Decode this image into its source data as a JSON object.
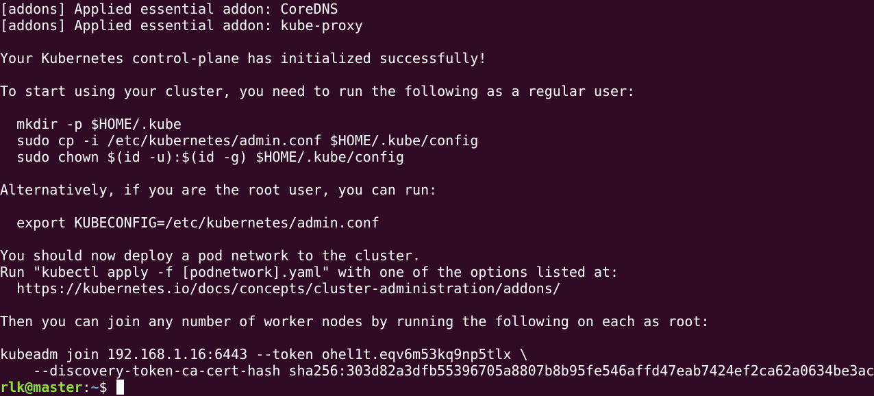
{
  "terminal": {
    "lines": [
      "[addons] Applied essential addon: CoreDNS",
      "[addons] Applied essential addon: kube-proxy",
      "",
      "Your Kubernetes control-plane has initialized successfully!",
      "",
      "To start using your cluster, you need to run the following as a regular user:",
      "",
      "  mkdir -p $HOME/.kube",
      "  sudo cp -i /etc/kubernetes/admin.conf $HOME/.kube/config",
      "  sudo chown $(id -u):$(id -g) $HOME/.kube/config",
      "",
      "Alternatively, if you are the root user, you can run:",
      "",
      "  export KUBECONFIG=/etc/kubernetes/admin.conf",
      "",
      "You should now deploy a pod network to the cluster.",
      "Run \"kubectl apply -f [podnetwork].yaml\" with one of the options listed at:",
      "  https://kubernetes.io/docs/concepts/cluster-administration/addons/",
      "",
      "Then you can join any number of worker nodes by running the following on each as root:",
      "",
      "kubeadm join 192.168.1.16:6443 --token ohel1t.eqv6m53kq9np5tlx \\",
      "    --discovery-token-ca-cert-hash sha256:303d82a3dfb55396705a8807b8b95fe546affd47eab7424ef2ca62a0634be3ac"
    ],
    "prompt": {
      "user_host": "rlk@master",
      "separator": ":",
      "path": "~",
      "symbol": "$ "
    },
    "colors": {
      "background": "#300a24",
      "text": "#ffffff",
      "user_host": "#8ae234",
      "path": "#729fcf"
    }
  }
}
